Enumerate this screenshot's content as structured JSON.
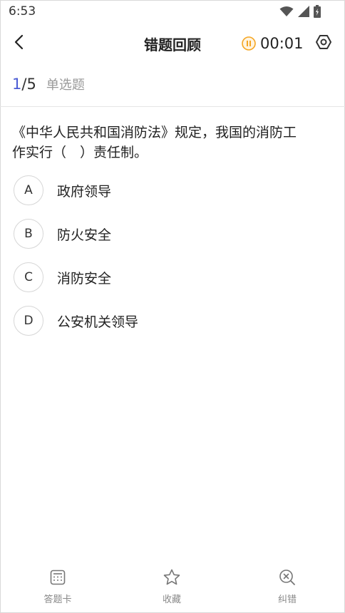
{
  "status_bar": {
    "time": "6:53",
    "icons": [
      "wifi-icon",
      "signal-icon",
      "battery-icon"
    ]
  },
  "header": {
    "title": "错题回顾",
    "timer": "00:01",
    "icons": [
      "back-icon",
      "pause-icon",
      "settings-icon"
    ],
    "accent_color": "#f5a623"
  },
  "progress": {
    "current": "1",
    "separator": "/",
    "total": "5",
    "question_type": "单选题",
    "current_color": "#4a5bd4"
  },
  "question": {
    "line1": "《中华人民共和国消防法》规定，我国的消防工",
    "line2": "作实行（　）责任制。"
  },
  "options": [
    {
      "letter": "A",
      "text": "政府领导"
    },
    {
      "letter": "B",
      "text": "防火安全"
    },
    {
      "letter": "C",
      "text": "消防安全"
    },
    {
      "letter": "D",
      "text": "公安机关领导"
    }
  ],
  "bottom_bar": [
    {
      "label": "答题卡",
      "icon": "answer-card-icon"
    },
    {
      "label": "收藏",
      "icon": "star-icon"
    },
    {
      "label": "纠错",
      "icon": "error-report-icon"
    }
  ]
}
